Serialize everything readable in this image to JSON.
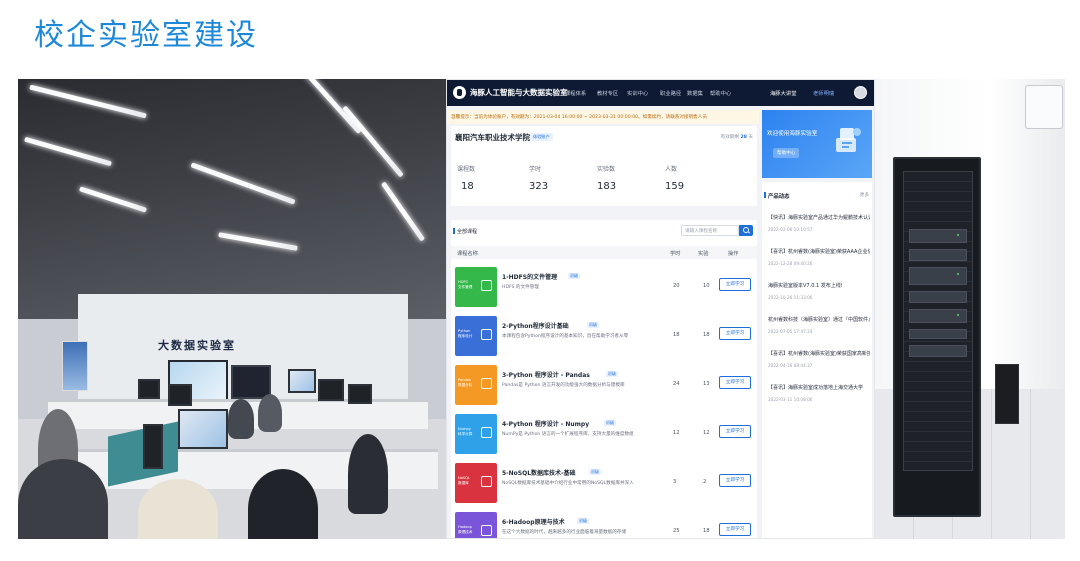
{
  "slide": {
    "title": "校企实验室建设"
  },
  "classroom_photo": {
    "wall_sign": "大数据实验室"
  },
  "web": {
    "logo": "海豚人工智能与大数据实验室",
    "nav": [
      "课程体系",
      "教材专区",
      "实训中心",
      "职业路径",
      "数据集",
      "帮助中心"
    ],
    "nav_right": [
      "海豚大讲堂",
      "老师明瑞"
    ],
    "notice": "温馨提示：当前为体验账户，有效期为：2021-03-04 16:00:00 ~ 2023-03-31 00:00:00。如需续约，请联系对接销售人员",
    "school": {
      "name": "襄阳汽车职业技术学院",
      "tag": "体验账户",
      "expire_label": "有效期剩",
      "expire_value": "28",
      "expire_unit": "天"
    },
    "stats": [
      {
        "label": "课程数",
        "value": "18"
      },
      {
        "label": "学时",
        "value": "323"
      },
      {
        "label": "实验数",
        "value": "183"
      },
      {
        "label": "人数",
        "value": "159"
      }
    ],
    "course_panel": {
      "title": "全部课程",
      "search_placeholder": "请输入课程名称",
      "headers": {
        "name": "课程名称",
        "hours": "学时",
        "labs": "实验",
        "action": "操作"
      },
      "button_label": "立即学习",
      "courses": [
        {
          "title": "1-HDFS的文件管理",
          "tag": "初级",
          "desc": "HDFS 的文件管理",
          "hours": "20",
          "labs": "10",
          "thumb_text": "HDFS\n文件管理",
          "color": "#35b84a"
        },
        {
          "title": "2-Python程序设计基础",
          "tag": "初级",
          "desc": "本课程包含Python程序设计的基本知识，旨在帮助学习者从零",
          "hours": "18",
          "labs": "18",
          "thumb_text": "Python\n程序设计",
          "color": "#3b6fd8"
        },
        {
          "title": "3-Python 程序设计 - Pandas",
          "tag": "初级",
          "desc": "Pandas是 Python 语言开发的功能强大的数据分析与建模库",
          "hours": "24",
          "labs": "13",
          "thumb_text": "Pandas\n数据分析",
          "color": "#f49a24"
        },
        {
          "title": "4-Python 程序设计 - Numpy",
          "tag": "初级",
          "desc": "NumPy是 Python 语言的一个扩展程序库，支持大量的维度数组",
          "hours": "12",
          "labs": "12",
          "thumb_text": "Numpy\n科学计算",
          "color": "#2ea1e8"
        },
        {
          "title": "5-NoSQL数据库技术-基础",
          "tag": "初级",
          "desc": "NoSQL数据库技术基础中介绍行业中常用的NoSQL数据库并深入",
          "hours": "3",
          "labs": "2",
          "thumb_text": "NoSQL\n数据库",
          "color": "#d9333f"
        },
        {
          "title": "6-Hadoop原理与技术",
          "tag": "初级",
          "desc": "在这个大数据的时代，越来越多的行业面临着海量数据的存储",
          "hours": "25",
          "labs": "18",
          "thumb_text": "Hadoop\n原理技术",
          "color": "#7a55d9"
        }
      ]
    },
    "welcome": {
      "text": "欢迎使用海豚实验室",
      "help": "帮助中心"
    },
    "news": {
      "title": "产品动态",
      "more": "更多",
      "items": [
        {
          "head": "【快讯】海豚实验室产品通过华为鲲鹏技术认证",
          "date": "2022-02-06 10:10:57"
        },
        {
          "head": "【喜讯】杭州睿数(海豚实验室)荣获AAA企业信用等级",
          "date": "2022-12-28 09:40:26"
        },
        {
          "head": "海豚实验室版本V7.0.1 发布上线!",
          "date": "2022-10-26 11:33:06"
        },
        {
          "head": "杭州睿数科技（海豚实验室）通过『中国软件』认证",
          "date": "2022-07-05 17:47:24"
        },
        {
          "head": "【喜讯】杭州睿数(海豚实验室)荣获国家高新技术企业",
          "date": "2022-04-16 08:44:37"
        },
        {
          "head": "【喜讯】海豚实验室成功落地上海交通大学",
          "date": "2022-03-11 10:08:06"
        }
      ]
    }
  }
}
